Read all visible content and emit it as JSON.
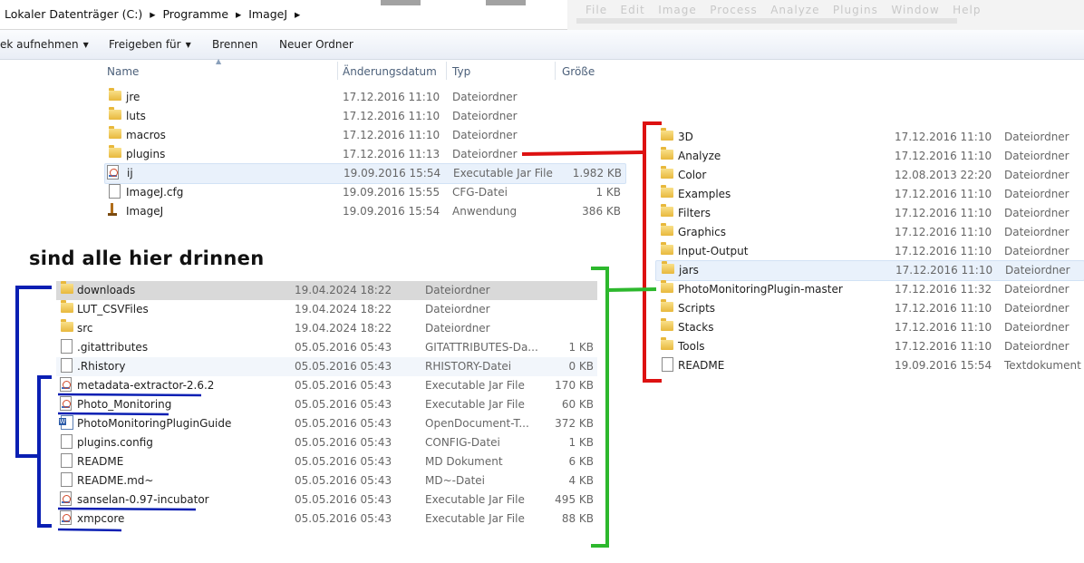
{
  "address": {
    "path": "Lokaler Datenträger (C:)  ▸  Programme  ▸  ImageJ  ▸"
  },
  "background_window": {
    "menu_ghost": "File   Edit   Image   Process   Analyze   Plugins   Window   Help"
  },
  "toolbar": {
    "include_label": "ek aufnehmen",
    "share_label": "Freigeben für",
    "burn_label": "Brennen",
    "new_folder_label": "Neuer Ordner"
  },
  "columns": {
    "name": "Name",
    "date": "Änderungsdatum",
    "type": "Typ",
    "size": "Größe"
  },
  "top_files": [
    {
      "name": "jre",
      "date": "17.12.2016 11:10",
      "type": "Dateiordner",
      "size": "",
      "icon": "folder-icon"
    },
    {
      "name": "luts",
      "date": "17.12.2016 11:10",
      "type": "Dateiordner",
      "size": "",
      "icon": "folder-icon"
    },
    {
      "name": "macros",
      "date": "17.12.2016 11:10",
      "type": "Dateiordner",
      "size": "",
      "icon": "folder-icon"
    },
    {
      "name": "plugins",
      "date": "17.12.2016 11:13",
      "type": "Dateiordner",
      "size": "",
      "icon": "folder-icon"
    },
    {
      "name": "ij",
      "date": "19.09.2016 15:54",
      "type": "Executable Jar File",
      "size": "1.982 KB",
      "icon": "jar-icon"
    },
    {
      "name": "ImageJ.cfg",
      "date": "19.09.2016 15:55",
      "type": "CFG-Datei",
      "size": "1 KB",
      "icon": "document-icon"
    },
    {
      "name": "ImageJ",
      "date": "19.09.2016 15:54",
      "type": "Anwendung",
      "size": "386 KB",
      "icon": "imagej-microscope-icon"
    }
  ],
  "plugin_folders": [
    {
      "name": "3D",
      "date": "17.12.2016 11:10",
      "type": "Dateiordner",
      "icon": "folder-icon"
    },
    {
      "name": "Analyze",
      "date": "17.12.2016 11:10",
      "type": "Dateiordner",
      "icon": "folder-icon"
    },
    {
      "name": "Color",
      "date": "12.08.2013 22:20",
      "type": "Dateiordner",
      "icon": "folder-icon"
    },
    {
      "name": "Examples",
      "date": "17.12.2016 11:10",
      "type": "Dateiordner",
      "icon": "folder-icon"
    },
    {
      "name": "Filters",
      "date": "17.12.2016 11:10",
      "type": "Dateiordner",
      "icon": "folder-icon"
    },
    {
      "name": "Graphics",
      "date": "17.12.2016 11:10",
      "type": "Dateiordner",
      "icon": "folder-icon"
    },
    {
      "name": "Input-Output",
      "date": "17.12.2016 11:10",
      "type": "Dateiordner",
      "icon": "folder-icon"
    },
    {
      "name": "jars",
      "date": "17.12.2016 11:10",
      "type": "Dateiordner",
      "icon": "folder-icon"
    },
    {
      "name": "PhotoMonitoringPlugin-master",
      "date": "17.12.2016 11:32",
      "type": "Dateiordner",
      "icon": "folder-icon"
    },
    {
      "name": "Scripts",
      "date": "17.12.2016 11:10",
      "type": "Dateiordner",
      "icon": "folder-icon"
    },
    {
      "name": "Stacks",
      "date": "17.12.2016 11:10",
      "type": "Dateiordner",
      "icon": "folder-icon"
    },
    {
      "name": "Tools",
      "date": "17.12.2016 11:10",
      "type": "Dateiordner",
      "icon": "folder-icon"
    },
    {
      "name": "README",
      "date": "19.09.2016 15:54",
      "type": "Textdokument",
      "icon": "document-icon"
    }
  ],
  "annotation": {
    "text": "sind alle hier drinnen"
  },
  "pm_files": [
    {
      "name": "downloads",
      "date": "19.04.2024 18:22",
      "type": "Dateiordner",
      "size": "",
      "icon": "folder-icon"
    },
    {
      "name": "LUT_CSVFiles",
      "date": "19.04.2024 18:22",
      "type": "Dateiordner",
      "size": "",
      "icon": "folder-icon"
    },
    {
      "name": "src",
      "date": "19.04.2024 18:22",
      "type": "Dateiordner",
      "size": "",
      "icon": "folder-icon"
    },
    {
      "name": ".gitattributes",
      "date": "05.05.2016 05:43",
      "type": "GITATTRIBUTES-Da...",
      "size": "1 KB",
      "icon": "document-icon"
    },
    {
      "name": ".Rhistory",
      "date": "05.05.2016 05:43",
      "type": "RHISTORY-Datei",
      "size": "0 KB",
      "icon": "document-icon"
    },
    {
      "name": "metadata-extractor-2.6.2",
      "date": "05.05.2016 05:43",
      "type": "Executable Jar File",
      "size": "170 KB",
      "icon": "jar-icon"
    },
    {
      "name": "Photo_Monitoring",
      "date": "05.05.2016 05:43",
      "type": "Executable Jar File",
      "size": "60 KB",
      "icon": "jar-icon"
    },
    {
      "name": "PhotoMonitoringPluginGuide",
      "date": "05.05.2016 05:43",
      "type": "OpenDocument-T...",
      "size": "372 KB",
      "icon": "word-document-icon"
    },
    {
      "name": "plugins.config",
      "date": "05.05.2016 05:43",
      "type": "CONFIG-Datei",
      "size": "1 KB",
      "icon": "document-icon"
    },
    {
      "name": "README",
      "date": "05.05.2016 05:43",
      "type": "MD Dokument",
      "size": "6 KB",
      "icon": "document-icon"
    },
    {
      "name": "README.md~",
      "date": "05.05.2016 05:43",
      "type": "MD~-Datei",
      "size": "4 KB",
      "icon": "document-icon"
    },
    {
      "name": "sanselan-0.97-incubator",
      "date": "05.05.2016 05:43",
      "type": "Executable Jar File",
      "size": "495 KB",
      "icon": "jar-icon"
    },
    {
      "name": "xmpcore",
      "date": "05.05.2016 05:43",
      "type": "Executable Jar File",
      "size": "88 KB",
      "icon": "jar-icon"
    }
  ],
  "colors": {
    "red_bracket": "#dd1111",
    "green_bracket": "#2db82d",
    "blue_marks": "#0a1fb3",
    "header_text": "#4c607a"
  }
}
